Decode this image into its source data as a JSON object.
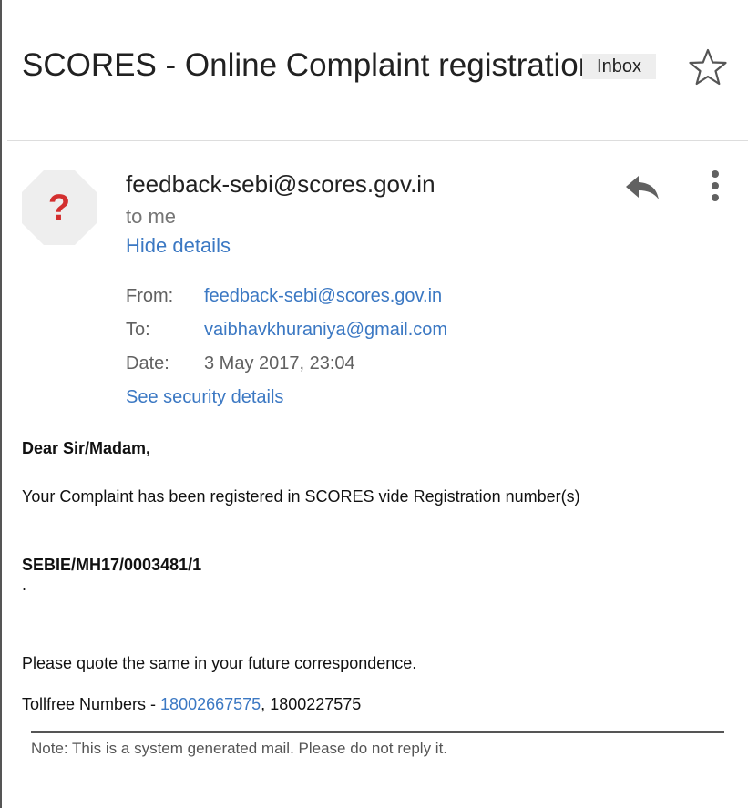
{
  "subject": {
    "title": "SCORES - Online Complaint registration",
    "label": "Inbox",
    "star_icon": "star-outline-icon"
  },
  "header": {
    "avatar_icon": "unknown-sender-icon",
    "avatar_glyph": "?",
    "sender": "feedback-sebi@scores.gov.in",
    "to_me": "to me",
    "hide_details": "Hide details",
    "reply_icon": "reply-icon",
    "more_icon": "more-vertical-icon"
  },
  "details": {
    "from_label": "From:",
    "from_value": "feedback-sebi@scores.gov.in",
    "to_label": "To:",
    "to_value": "vaibhavkhuraniya@gmail.com",
    "date_label": "Date:",
    "date_value": "3 May 2017, 23:04",
    "security_link": "See security details"
  },
  "body": {
    "greeting": "Dear Sir/Madam,",
    "line1": "Your Complaint has been registered in SCORES vide Registration number(s)",
    "registration_number": "SEBIE/MH17/0003481/1",
    "dot": ".",
    "line2": "Please quote the same in your future correspondence.",
    "tollfree_label": "Tollfree Numbers - ",
    "tollfree_1": "18002667575",
    "tollfree_sep": ", ",
    "tollfree_2": "1800227575",
    "note": "Note: This is a system generated mail. Please do not reply it."
  },
  "colors": {
    "link": "#3b78c3",
    "avatar_bg": "#eeeeee",
    "avatar_glyph": "#d32f2f",
    "badge_bg": "#eeeeee"
  }
}
